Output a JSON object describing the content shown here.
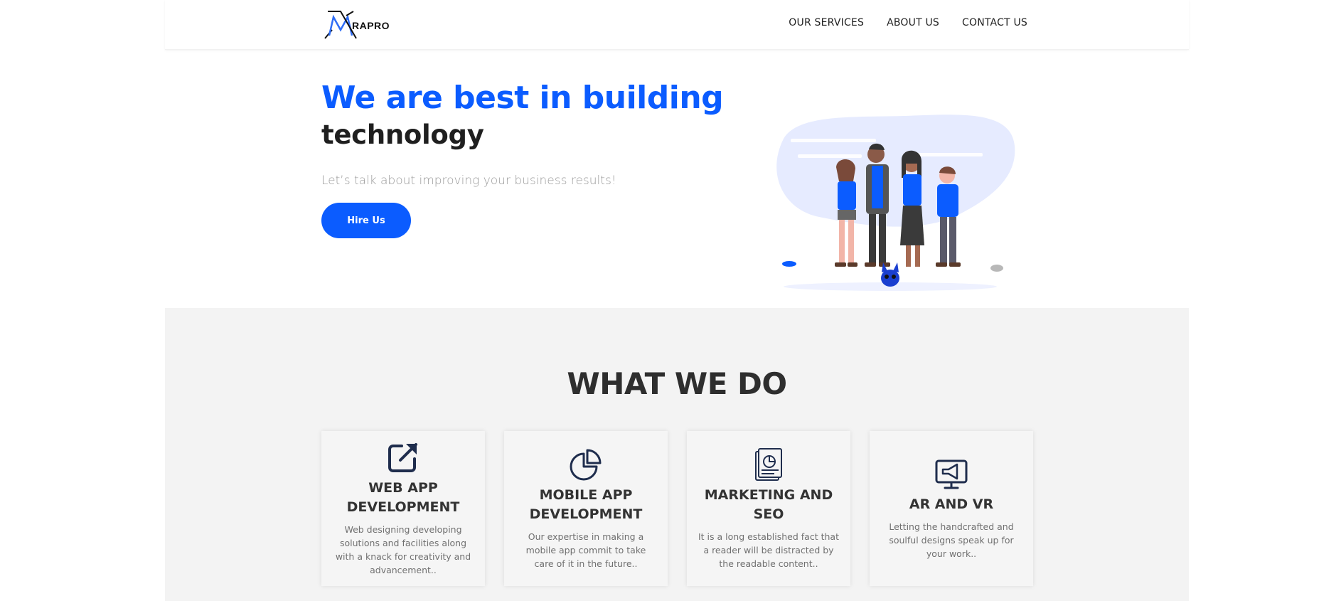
{
  "brand": {
    "logo_text": "RAPRO"
  },
  "nav": {
    "items": [
      {
        "label": "OUR SERVICES"
      },
      {
        "label": "ABOUT US"
      },
      {
        "label": "CONTACT US"
      }
    ]
  },
  "hero": {
    "title_line1": "We are best in building",
    "title_line2": "technology",
    "subtitle": "Let’s talk about improving your business results!",
    "cta_label": "Hire Us",
    "accent_color": "#0b5cff"
  },
  "services": {
    "heading": "WHAT WE DO",
    "cards": [
      {
        "icon": "external-link-icon",
        "title": "WEB APP DEVELOPMENT",
        "desc": "Web designing developing solutions and facilities along with a knack for creativity and advancement.."
      },
      {
        "icon": "pie-chart-icon",
        "title": "MOBILE APP DEVELOPMENT",
        "desc": "Our expertise in making a mobile app commit to take care of it in the future.."
      },
      {
        "icon": "report-document-icon",
        "title": "MARKETING AND SEO",
        "desc": "It is a long established fact that a reader will be distracted by the readable content.."
      },
      {
        "icon": "monitor-megaphone-icon",
        "title": "AR AND VR",
        "desc": "Letting the handcrafted and soulful designs speak up for your work.."
      }
    ]
  }
}
